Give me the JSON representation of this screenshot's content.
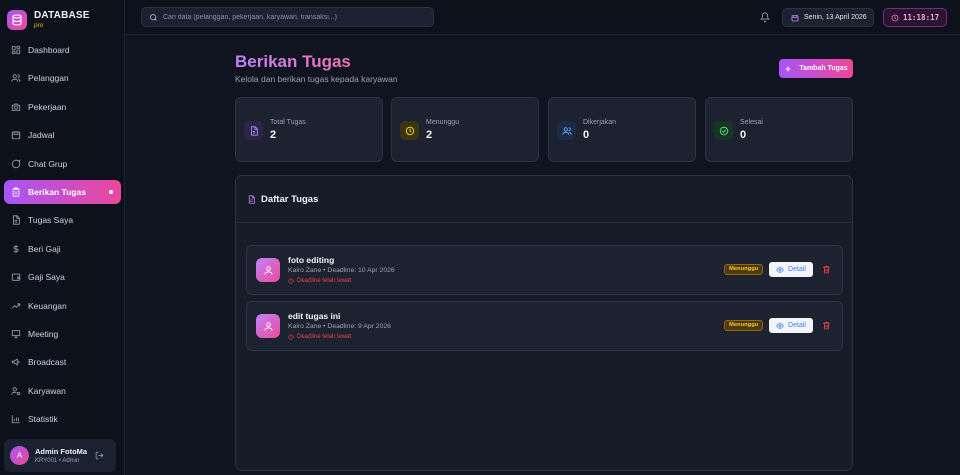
{
  "brand": {
    "title": "DATABASE",
    "sub": "pro"
  },
  "sidebar": {
    "items": [
      {
        "label": "Dashboard",
        "icon": "grid-icon"
      },
      {
        "label": "Pelanggan",
        "icon": "users-icon"
      },
      {
        "label": "Pekerjaan",
        "icon": "camera-icon"
      },
      {
        "label": "Jadwal",
        "icon": "calendar-icon"
      },
      {
        "label": "Chat Grup",
        "icon": "chat-icon"
      },
      {
        "label": "Berikan Tugas",
        "icon": "clipboard-icon",
        "active": true
      },
      {
        "label": "Tugas Saya",
        "icon": "file-icon"
      },
      {
        "label": "Beri Gaji",
        "icon": "dollar-icon"
      },
      {
        "label": "Gaji Saya",
        "icon": "wallet-icon"
      },
      {
        "label": "Keuangan",
        "icon": "trending-up-icon"
      },
      {
        "label": "Meeting",
        "icon": "presentation-icon"
      },
      {
        "label": "Broadcast",
        "icon": "megaphone-icon"
      },
      {
        "label": "Karyawan",
        "icon": "user-cog-icon"
      },
      {
        "label": "Statistik",
        "icon": "bar-chart-icon"
      }
    ],
    "user": {
      "initial": "A",
      "name": "Admin FotoMan",
      "role": "KRY001 • Admin"
    }
  },
  "topbar": {
    "search_placeholder": "Cari data (pelanggan, pekerjaan, karyawan, transaksi...)",
    "date": "Senin, 13 April 2026",
    "time": "11:18:17"
  },
  "page": {
    "title": "Berikan Tugas",
    "subtitle": "Kelola dan berikan tugas kepada karyawan",
    "add_label": "Tambah Tugas"
  },
  "stats": [
    {
      "label": "Total Tugas",
      "value": "2",
      "icon": "file-text-icon",
      "color": "#a78bfa",
      "bg": "#2e2446"
    },
    {
      "label": "Menunggu",
      "value": "2",
      "icon": "clock-icon",
      "color": "#facc15",
      "bg": "#3b3417"
    },
    {
      "label": "Dikerjakan",
      "value": "0",
      "icon": "users-icon",
      "color": "#60a5fa",
      "bg": "#1c2b45"
    },
    {
      "label": "Selesai",
      "value": "0",
      "icon": "check-circle-icon",
      "color": "#4ade80",
      "bg": "#173425"
    }
  ],
  "panel": {
    "title": "Daftar Tugas"
  },
  "tasks": [
    {
      "title": "foto editing",
      "meta": "Kairo Zane • Deadline: 10 Apr 2026",
      "warning": "Deadline telah lewat",
      "status": "Menunggu",
      "detail_label": "Detail"
    },
    {
      "title": "edit tugas ini",
      "meta": "Kairo Zane • Deadline: 9 Apr 2026",
      "warning": "Deadline telah lewat",
      "status": "Menunggu",
      "detail_label": "Detail"
    }
  ]
}
